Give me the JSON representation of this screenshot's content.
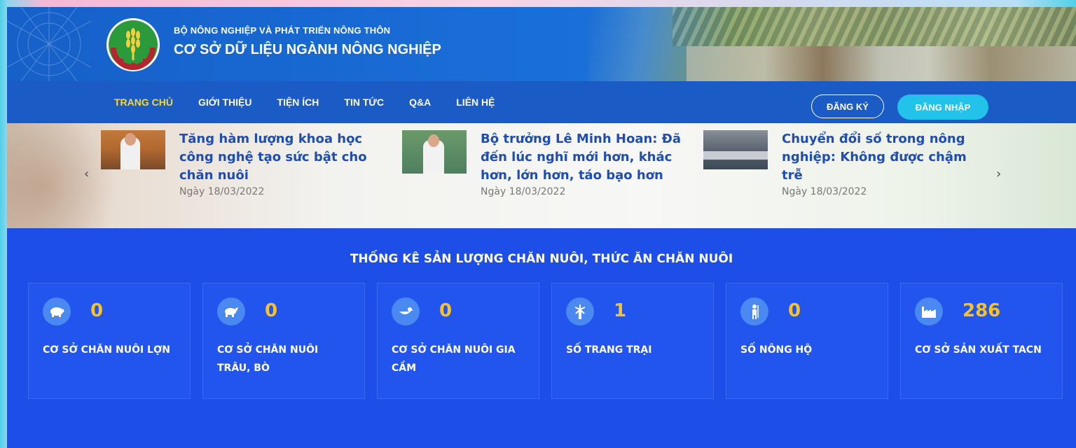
{
  "header": {
    "org_top": "BỘ NÔNG NGHIỆP VÀ PHÁT TRIỂN NÔNG THÔN",
    "org_main": "CƠ SỞ DỮ LIỆU NGÀNH NÔNG NGHIỆP"
  },
  "nav": {
    "items": [
      {
        "label": "TRANG CHỦ",
        "active": true
      },
      {
        "label": "GIỚI THIỆU"
      },
      {
        "label": "TIỆN ÍCH"
      },
      {
        "label": "TIN TỨC"
      },
      {
        "label": "Q&A"
      },
      {
        "label": "LIÊN HỆ"
      }
    ],
    "register": "ĐĂNG KÝ",
    "login": "ĐĂNG NHẬP"
  },
  "news": {
    "prev": "‹",
    "next": "›",
    "items": [
      {
        "title": "Tăng hàm lượng khoa học công nghệ tạo sức bật cho chăn nuôi",
        "date": "Ngày 18/03/2022"
      },
      {
        "title": "Bộ trưởng Lê Minh Hoan: Đã đến lúc nghĩ mới hơn, khác hơn, lớn hơn, táo bạo hơn",
        "date": "Ngày 18/03/2022"
      },
      {
        "title": "Chuyển đổi số trong nông nghiệp: Không được chậm trễ",
        "date": "Ngày 18/03/2022"
      }
    ]
  },
  "stats": {
    "title": "THỐNG KÊ SẢN LƯỢNG CHĂN NUÔI, THỨC ĂN CHĂN NUÔI",
    "cards": [
      {
        "icon": "pig-icon",
        "value": "0",
        "label": "CƠ SỞ CHĂN NUÔI LỢN"
      },
      {
        "icon": "buffalo-icon",
        "value": "0",
        "label": "CƠ SỞ CHĂN NUÔI TRÂU, BÒ"
      },
      {
        "icon": "duck-icon",
        "value": "0",
        "label": "CƠ SỞ CHĂN NUÔI GIA CẦM"
      },
      {
        "icon": "windmill-icon",
        "value": "1",
        "label": "SỐ TRANG TRẠI"
      },
      {
        "icon": "farmer-icon",
        "value": "0",
        "label": "SỐ NÔNG HỘ"
      },
      {
        "icon": "factory-icon",
        "value": "286",
        "label": "CƠ SỞ SẢN XUẤT TACN"
      }
    ]
  }
}
